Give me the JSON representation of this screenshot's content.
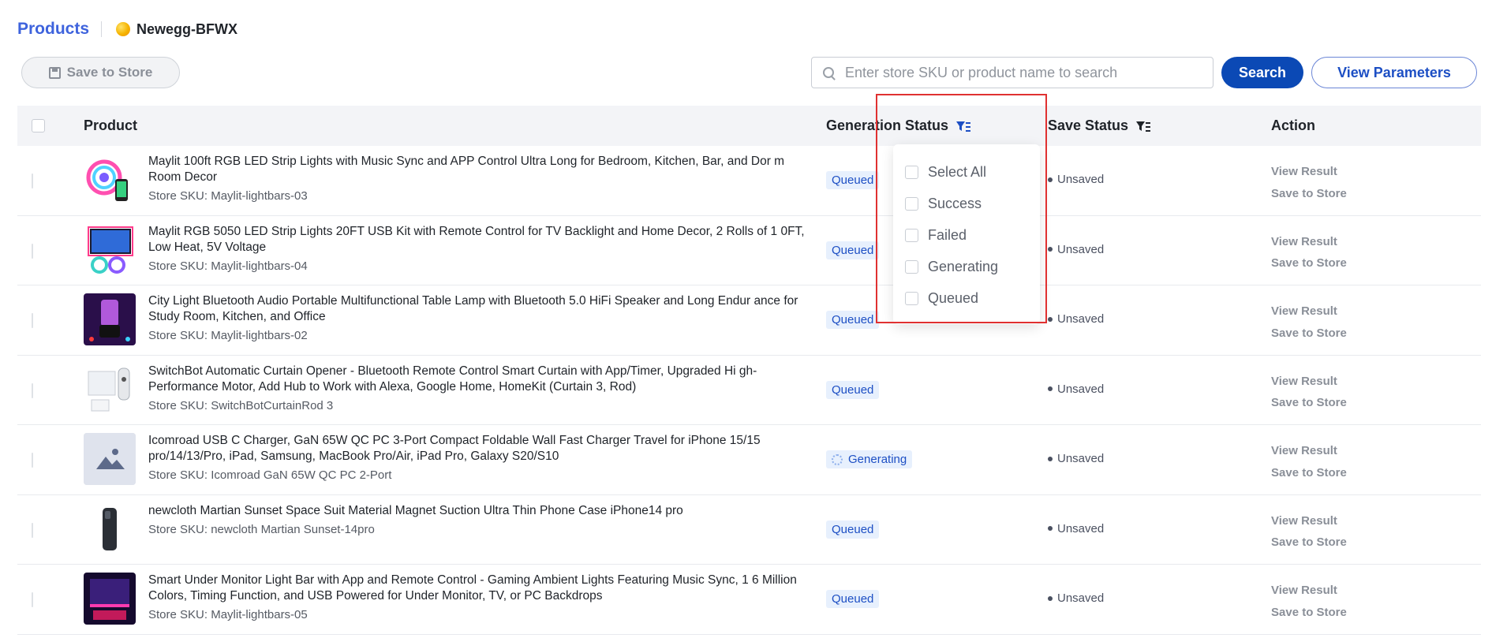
{
  "breadcrumb": {
    "products": "Products",
    "store_name": "Newegg-BFWX"
  },
  "toolbar": {
    "save_to_store": "Save to Store",
    "search_placeholder": "Enter store SKU or product name to search",
    "search_value": "",
    "search_button": "Search",
    "view_parameters": "View Parameters"
  },
  "table": {
    "headers": {
      "product": "Product",
      "generation_status": "Generation Status",
      "save_status": "Save Status",
      "action": "Action"
    },
    "rows": [
      {
        "name": "Maylit 100ft RGB LED Strip Lights with Music Sync and APP Control Ultra Long for Bedroom, Kitchen, Bar, and Dor m Room Decor",
        "sku": "Store SKU: Maylit-lightbars-03",
        "status": "Queued",
        "save": "Unsaved",
        "view": "View Result",
        "save_action": "Save to Store",
        "thumb": "led-strip"
      },
      {
        "name": "Maylit RGB 5050 LED Strip Lights 20FT USB Kit with Remote Control for TV Backlight and Home Decor, 2 Rolls of 1 0FT, Low Heat, 5V Voltage",
        "sku": "Store SKU: Maylit-lightbars-04",
        "status": "Queued",
        "save": "Unsaved",
        "view": "View Result",
        "save_action": "Save to Store",
        "thumb": "tv-backlight"
      },
      {
        "name": "City Light Bluetooth Audio Portable Multifunctional Table Lamp with Bluetooth 5.0 HiFi Speaker and Long Endur ance for Study Room, Kitchen, and Office",
        "sku": "Store SKU: Maylit-lightbars-02",
        "status": "Queued",
        "save": "Unsaved",
        "view": "View Result",
        "save_action": "Save to Store",
        "thumb": "table-lamp"
      },
      {
        "name": "SwitchBot Automatic Curtain Opener - Bluetooth Remote Control Smart Curtain with App/Timer, Upgraded Hi gh-Performance Motor, Add Hub to Work with Alexa, Google Home, HomeKit (Curtain 3, Rod)",
        "sku": "Store SKU: SwitchBotCurtainRod 3",
        "status": "Queued",
        "save": "Unsaved",
        "view": "View Result",
        "save_action": "Save to Store",
        "thumb": "curtain-opener"
      },
      {
        "name": "Icomroad USB C Charger, GaN 65W QC PC 3-Port Compact Foldable Wall Fast Charger Travel for iPhone 15/15 pro/14/13/Pro, iPad, Samsung, MacBook Pro/Air, iPad Pro, Galaxy S20/S10",
        "sku": "Store SKU: Icomroad GaN 65W QC PC 2-Port",
        "status": "Generating",
        "save": "Unsaved",
        "view": "View Result",
        "save_action": "Save to Store",
        "thumb": "placeholder"
      },
      {
        "name": "newcloth Martian Sunset Space Suit Material Magnet Suction Ultra Thin Phone Case iPhone14 pro",
        "sku": "Store SKU: newcloth Martian Sunset-14pro",
        "status": "Queued",
        "save": "Unsaved",
        "view": "View Result",
        "save_action": "Save to Store",
        "thumb": "phone-case"
      },
      {
        "name": "Smart Under Monitor Light Bar with App and Remote Control - Gaming Ambient Lights Featuring Music Sync, 1 6 Million Colors, Timing Function, and USB Powered for Under Monitor, TV, or PC Backdrops",
        "sku": "Store SKU: Maylit-lightbars-05",
        "status": "Queued",
        "save": "Unsaved",
        "view": "View Result",
        "save_action": "Save to Store",
        "thumb": "monitor-light"
      }
    ]
  },
  "filter_dropdown": {
    "options": [
      "Select All",
      "Success",
      "Failed",
      "Generating",
      "Queued"
    ]
  },
  "colors": {
    "accent": "#3e63dd",
    "primary_button": "#0b49b5",
    "highlight": "#e03131",
    "badge_bg": "#e7f0fd"
  }
}
